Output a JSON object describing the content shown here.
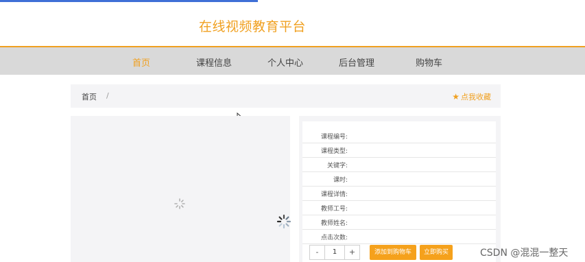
{
  "site_title": "在线视频教育平台",
  "nav": {
    "items": [
      {
        "label": "首页",
        "active": true
      },
      {
        "label": "课程信息",
        "active": false
      },
      {
        "label": "个人中心",
        "active": false
      },
      {
        "label": "后台管理",
        "active": false
      },
      {
        "label": "购物车",
        "active": false
      }
    ]
  },
  "breadcrumb": {
    "home": "首页",
    "separator": "/",
    "favorite": "点我收藏"
  },
  "details": {
    "fields": [
      {
        "label": "课程编号:"
      },
      {
        "label": "课程类型:"
      },
      {
        "label": "关键字:"
      },
      {
        "label": "课时:"
      },
      {
        "label": "课程详情:"
      },
      {
        "label": "教师工号:"
      },
      {
        "label": "教师姓名:"
      },
      {
        "label": "点击次数:"
      }
    ]
  },
  "actions": {
    "minus": "-",
    "quantity": "1",
    "plus": "+",
    "add_to_cart": "添加到购物车",
    "buy_now": "立即购买"
  },
  "watermark": "CSDN @混混一整天",
  "colors": {
    "accent": "#f0a020",
    "nav_bg": "#d9d9d9",
    "panel_bg": "#f4f4f6",
    "top_strip": "#3f6fd6"
  }
}
